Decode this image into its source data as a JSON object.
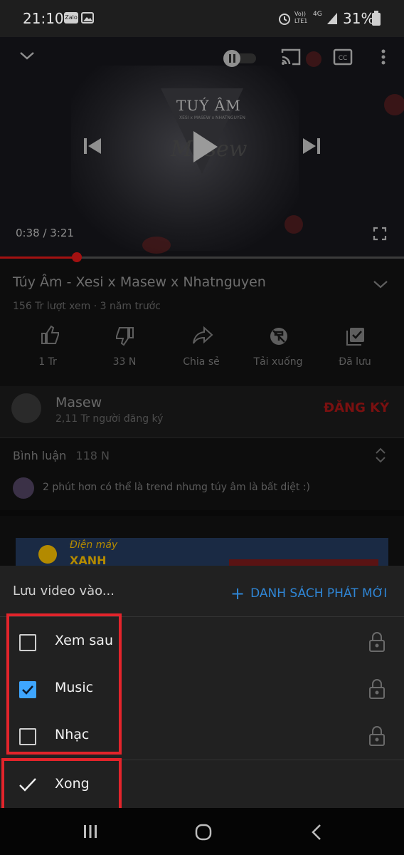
{
  "status_bar": {
    "time": "21:10",
    "left_icons": [
      "zalo-icon",
      "gallery-icon"
    ],
    "zalo_label": "Zalo",
    "right_icons": [
      "alarm-icon",
      "volte-icon",
      "4g-icon",
      "signal-icon",
      "battery-icon"
    ],
    "volte_line1": "Vo))",
    "volte_line2": "LTE1",
    "net_label": "4G",
    "battery": "31%"
  },
  "player": {
    "thumb_text": "TUÝ ÂM",
    "thumb_sub": "XESI x MASEW x NHATNGUYEN",
    "thumb_script": "Masew",
    "timecode": "0:38 / 3:21",
    "progress_fraction": 0.19,
    "icons": [
      "chevron-down-icon",
      "autoplay-toggle-icon",
      "cast-icon",
      "captions-icon",
      "more-icon",
      "previous-icon",
      "play-icon",
      "next-icon",
      "fullscreen-icon"
    ]
  },
  "video": {
    "title": "Túy Âm - Xesi x Masew x Nhatnguyen",
    "meta": "156 Tr lượt xem · 3 năm trước",
    "actions": [
      {
        "label": "1 Tr",
        "icon": "like-icon"
      },
      {
        "label": "33 N",
        "icon": "dislike-icon"
      },
      {
        "label": "Chia sẻ",
        "icon": "share-icon"
      },
      {
        "label": "Tải xuống",
        "icon": "download-off-icon"
      },
      {
        "label": "Đã lưu",
        "icon": "saved-icon"
      }
    ]
  },
  "channel": {
    "name": "Masew",
    "subscribers": "2,11 Tr người đăng ký",
    "subscribe_label": "ĐĂNG KÝ"
  },
  "comments": {
    "label": "Bình luận",
    "count": "118 N",
    "top_comment": "2 phút hơn có thể là trend nhưng túy âm là bất diệt :)"
  },
  "ad": {
    "brand_line1": "Điện máy",
    "brand_line2": "XANH"
  },
  "save_sheet": {
    "header": "Lưu video vào...",
    "new_playlist_label": "DANH SÁCH PHÁT MỚI",
    "playlists": [
      {
        "name": "Xem sau",
        "checked": false,
        "privacy": "private"
      },
      {
        "name": "Music",
        "checked": true,
        "privacy": "private"
      },
      {
        "name": "Nhạc",
        "checked": false,
        "privacy": "private"
      }
    ],
    "done_label": "Xong"
  },
  "colors": {
    "accent_blue": "#3ea6ff",
    "highlight_red": "#e3242b",
    "subscribe_red": "#7a1010"
  }
}
